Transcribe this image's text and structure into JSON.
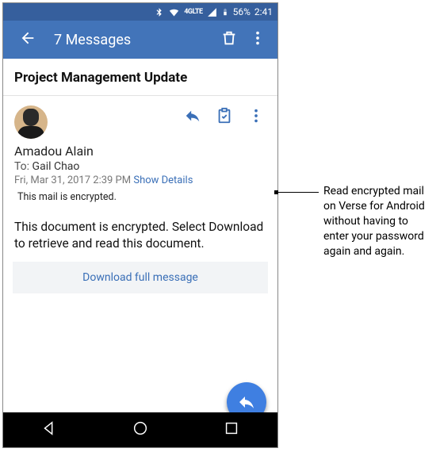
{
  "status": {
    "network_label": "4GLTE",
    "battery_pct": "56%",
    "time": "2:41"
  },
  "appbar": {
    "title": "7 Messages"
  },
  "subject": "Project Management Update",
  "sender": {
    "name": "Amadou Alain",
    "to_label": "To:",
    "to_value": "Gail Chao",
    "date": "Fri, Mar 31, 2017 2:39 PM",
    "details_link": "Show Details"
  },
  "encryption_note": "This mail is encrypted.",
  "body_text": "This document is encrypted. Select Download to retrieve and read this document.",
  "download_button": "Download full message",
  "callout_text": "Read encrypted mail on Verse for Android without having to enter your password again and again."
}
